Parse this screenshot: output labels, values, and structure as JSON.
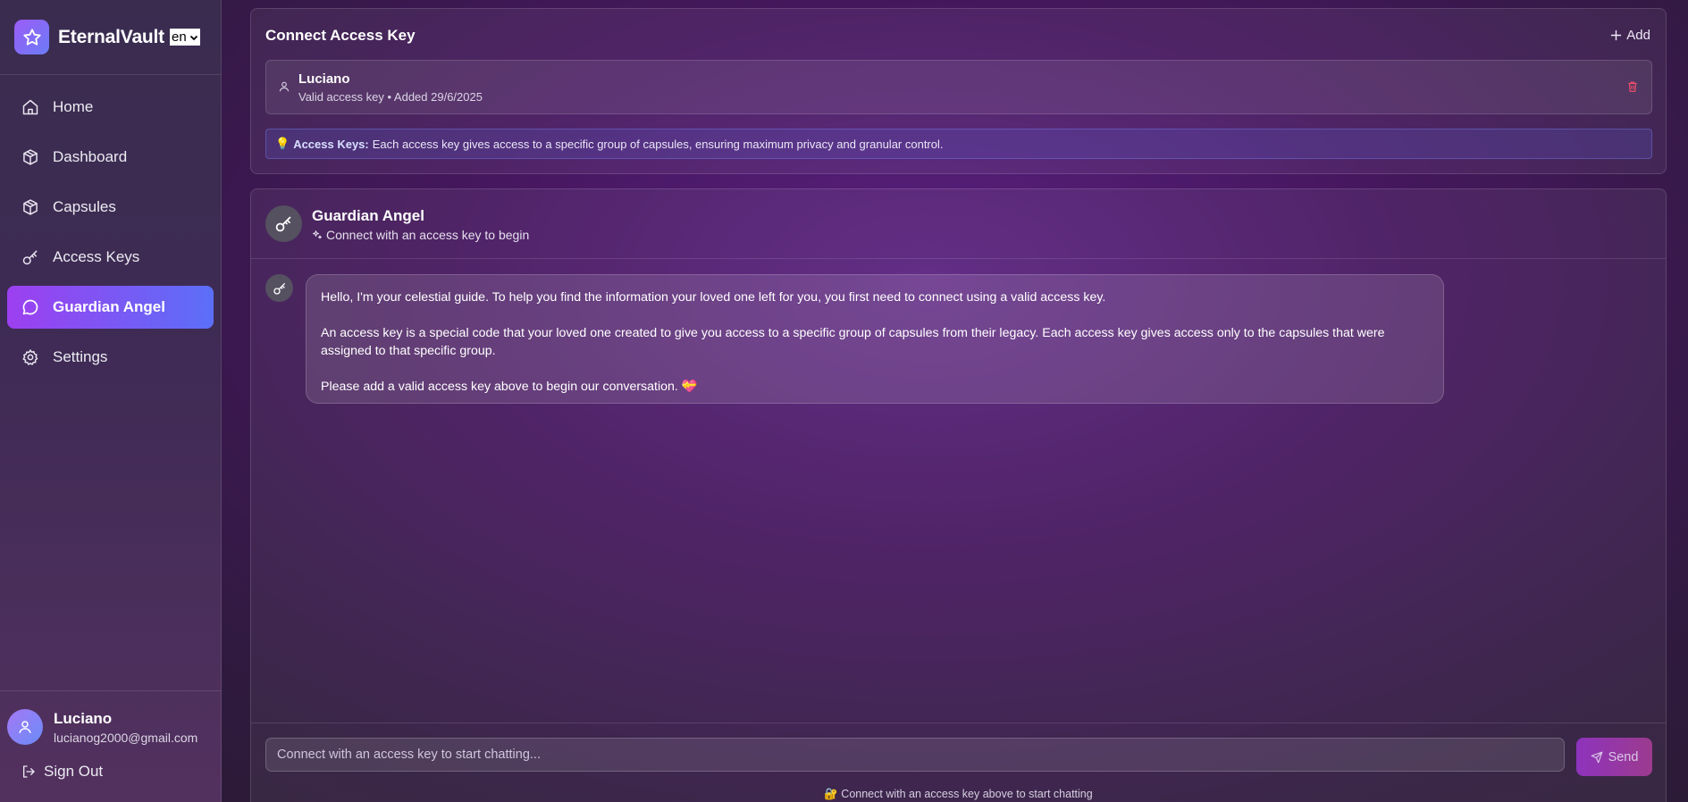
{
  "brand": {
    "name": "EternalVault",
    "language": "en"
  },
  "sidebar": {
    "items": [
      {
        "label": "Home",
        "icon": "home-icon"
      },
      {
        "label": "Dashboard",
        "icon": "box-icon"
      },
      {
        "label": "Capsules",
        "icon": "box-icon"
      },
      {
        "label": "Access Keys",
        "icon": "key-icon"
      },
      {
        "label": "Guardian Angel",
        "icon": "chat-bubble-icon",
        "active": true
      },
      {
        "label": "Settings",
        "icon": "gear-icon"
      }
    ],
    "user": {
      "name": "Luciano",
      "email": "lucianog2000@gmail.com"
    },
    "sign_out": "Sign Out"
  },
  "connect": {
    "title": "Connect Access Key",
    "add_label": "Add",
    "key": {
      "name": "Luciano",
      "meta": "Valid access key • Added 29/6/2025"
    },
    "info": {
      "emoji": "💡",
      "label": "Access Keys:",
      "text": "Each access key gives access to a specific group of capsules, ensuring maximum privacy and granular control."
    }
  },
  "chat": {
    "title": "Guardian Angel",
    "subtitle": "Connect with an access key to begin",
    "message": {
      "p1": "Hello, I'm your celestial guide. To help you find the information your loved one left for you, you first need to connect using a valid access key.",
      "p2": "An access key is a special code that your loved one created to give you access to a specific group of capsules from their legacy. Each access key gives access only to the capsules that were assigned to that specific group.",
      "p3": "Please add a valid access key above to begin our conversation. 💝"
    },
    "input_placeholder": "Connect with an access key to start chatting...",
    "send_label": "Send",
    "hint": "🔐 Connect with an access key above to start chatting"
  },
  "colors": {
    "accent_gradient_start": "#9d3ff0",
    "accent_gradient_end": "#5b6ff7",
    "delete": "#ef4f6a"
  }
}
